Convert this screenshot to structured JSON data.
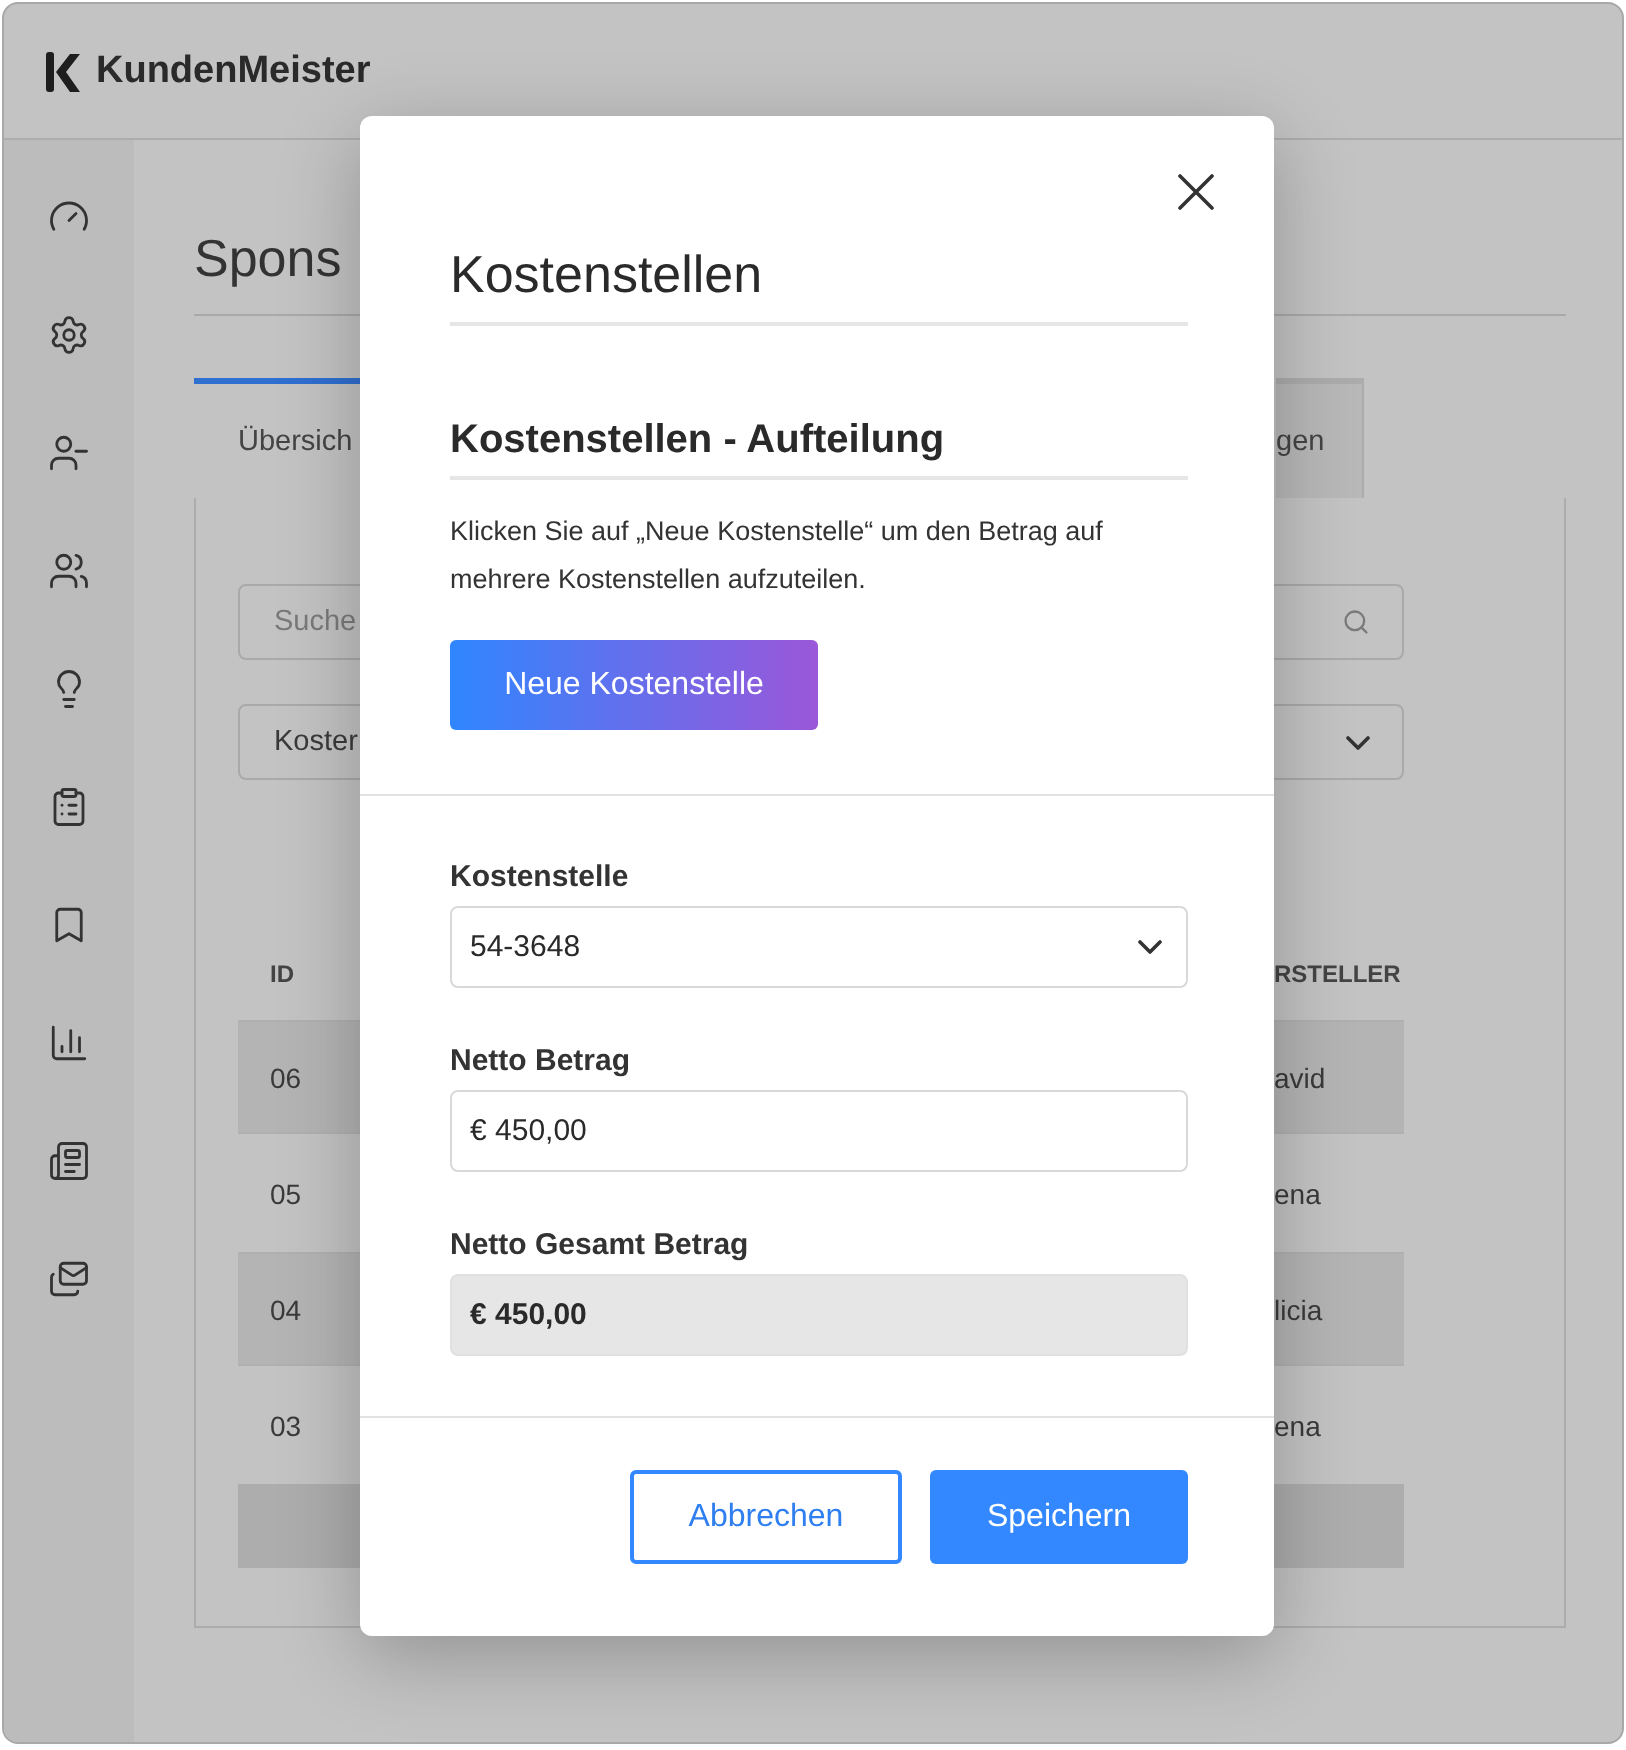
{
  "app": {
    "name": "KundenMeister"
  },
  "page": {
    "title": "Spons",
    "tabs": [
      {
        "label": "Übersich",
        "selected": true
      },
      {
        "label": "gen",
        "selected": false
      }
    ],
    "search": {
      "placeholder": "Suche"
    },
    "filter": {
      "value": "Koster"
    },
    "table": {
      "columns": [
        "ID",
        "RSTELLER"
      ],
      "rows": [
        {
          "cells": [
            "06",
            "avid"
          ]
        },
        {
          "cells": [
            "05",
            "ena"
          ]
        },
        {
          "cells": [
            "04",
            "licia"
          ]
        },
        {
          "cells": [
            "03",
            "ena"
          ]
        }
      ]
    }
  },
  "dialog": {
    "title": "Kostenstellen",
    "section_title": "Kostenstellen - Aufteilung",
    "description": "Klicken Sie auf „Neue Kostenstelle“ um den Betrag auf mehrere Kostenstellen aufzuteilen.",
    "new_button": "Neue Kostenstelle",
    "fields": [
      {
        "kind": "select",
        "label": "Kostenstelle",
        "value": "54-3648"
      },
      {
        "kind": "input",
        "label": "Netto Betrag",
        "value": "€ 450,00"
      },
      {
        "kind": "readonly",
        "label": "Netto Gesamt Betrag",
        "value": "€ 450,00"
      }
    ],
    "buttons": [
      {
        "kind": "secondary",
        "label": "Abbrechen"
      },
      {
        "kind": "primary",
        "label": "Speichern"
      }
    ]
  }
}
